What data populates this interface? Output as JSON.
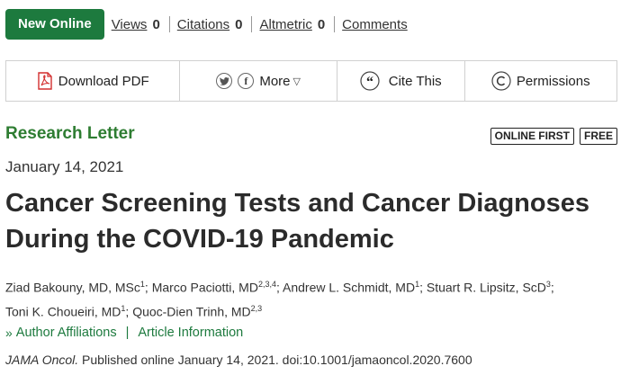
{
  "metrics": {
    "badge": "New Online",
    "views_label": "Views",
    "views_count": "0",
    "citations_label": "Citations",
    "citations_count": "0",
    "altmetric_label": "Altmetric",
    "altmetric_count": "0",
    "comments_label": "Comments"
  },
  "toolbar": {
    "download_label": "Download PDF",
    "more_label": "More",
    "cite_label": "Cite This",
    "permissions_label": "Permissions"
  },
  "article": {
    "type": "Research Letter",
    "tags": [
      "ONLINE FIRST",
      "FREE"
    ],
    "date": "January 14, 2021",
    "title": "Cancer Screening Tests and Cancer Diagnoses During the COVID-19 Pandemic",
    "authors": [
      {
        "name": "Ziad Bakouny, MD, MSc",
        "aff": "1"
      },
      {
        "name": "Marco Paciotti, MD",
        "aff": "2,3,4"
      },
      {
        "name": "Andrew L. Schmidt, MD",
        "aff": "1"
      },
      {
        "name": "Stuart R. Lipsitz, ScD",
        "aff": "3"
      },
      {
        "name": "Toni K. Choueiri, MD",
        "aff": "1"
      },
      {
        "name": "Quoc-Dien Trinh, MD",
        "aff": "2,3"
      }
    ],
    "author_affiliations_link": "Author Affiliations",
    "article_information_link": "Article Information",
    "journal": "JAMA Oncol.",
    "citation_rest": " Published online January 14, 2021. doi:10.1001/jamaoncol.2020.7600"
  },
  "colors": {
    "accent": "#1d7a3e",
    "pdf_red": "#d32f2f"
  },
  "icons": [
    "pdf-icon",
    "twitter-icon",
    "facebook-icon",
    "cite-quote-icon",
    "copyright-icon",
    "chevron-right-icon"
  ]
}
